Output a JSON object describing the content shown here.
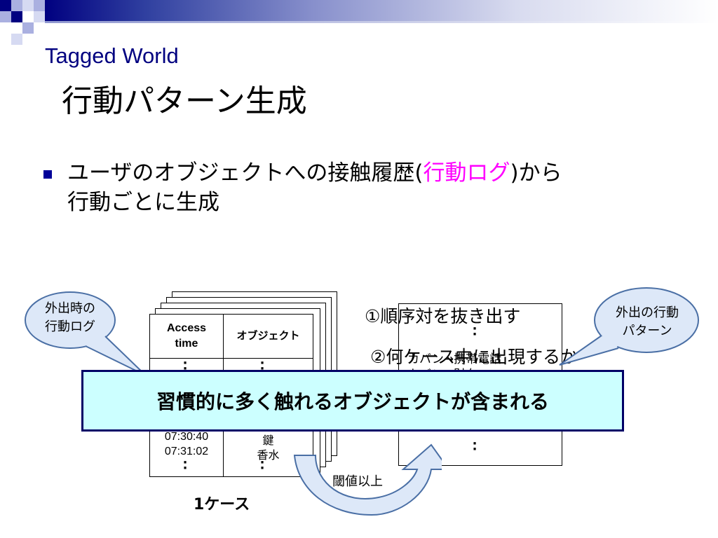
{
  "slide": {
    "title_en": "Tagged World",
    "title_ja": "行動パターン生成",
    "bullet": {
      "before": "ユーザのオブジェクトへの接触履歴(",
      "highlight": "行動ログ",
      "after": ")から",
      "line2": "行動ごとに生成"
    }
  },
  "log_table": {
    "col_time": "Access\ntime",
    "col_object": "オブジェクト",
    "rows": [
      {
        "time": "07:30:40",
        "object": "鍵"
      },
      {
        "time": "07:31:02",
        "object": "香水"
      }
    ],
    "case_label": "1ケース"
  },
  "bubbles": {
    "left": [
      "外出時の",
      "行動ログ"
    ],
    "right": [
      "外出の行動",
      "パターン"
    ]
  },
  "steps": {
    "step1": "①順序対を抜き出す",
    "step2": "②何ケース中に出現するか",
    "overlap": "カバン→携帯電話",
    "overlap2": "カバン→財布"
  },
  "banner": "習慣的に多く触れるオブジェクトが含まれる",
  "threshold": "閾値以上",
  "colors": {
    "title": "#000080",
    "highlight": "#ff00ff",
    "banner_bg": "#ccffff",
    "bubble": "#dde8f8",
    "arrow": "#dde8f8"
  }
}
